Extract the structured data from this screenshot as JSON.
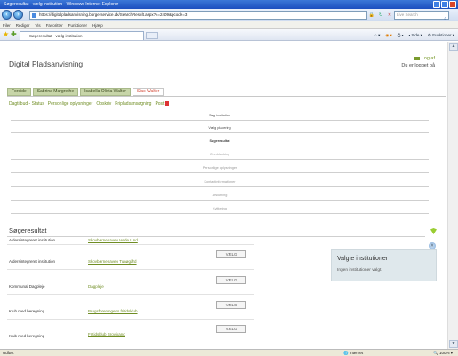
{
  "window": {
    "title": "Søgeresultat - vælg institution - Windows Internet Explorer"
  },
  "address": {
    "url": "https://digitalpladsanvisning.borgerservice.dk/SearchResult.aspx?c=2409&pcode=3",
    "live_search": "Live Search"
  },
  "menu": [
    "Filer",
    "Rediger",
    "Vis",
    "Favoritter",
    "Funktioner",
    "Hjælp"
  ],
  "tab": {
    "title": "Søgeresultat - vælg institution"
  },
  "toolbar": {
    "side": "Side",
    "funktioner": "Funktioner"
  },
  "site": {
    "title": "Digital Pladsanvisning",
    "logout": "Log af",
    "logged_in": "Du er logget på"
  },
  "children": [
    "Forside",
    "Sabrina Margrethe",
    "Isabella Olivia Walter",
    "Siac Walter"
  ],
  "subnav": [
    "Dagtilbud - Status",
    "Personlige oplysninger",
    "Opskriv",
    "Fripladsansøgning",
    "Post"
  ],
  "flow": [
    "Søg institution",
    "Vælg placering",
    "Søgeresultat",
    "Overblanking",
    "Personlige oplysninger",
    "Kontaktinformationer",
    "Afslutning",
    "Kvittering"
  ],
  "results": {
    "title": "Søgeresultat",
    "rows": [
      {
        "type": "Aldersintegreret institution",
        "name": "Skovbørnehaven Hede Lind"
      },
      {
        "type": "Aldersintegreret institution",
        "name": "Skovbørnehaven Tunøgård"
      },
      {
        "type": "Kommunal Dagpleje",
        "name": "Dagpleje"
      },
      {
        "type": "Klub med beregning",
        "name": "Brugsforeningens fritidsklub"
      },
      {
        "type": "Klub med beregning",
        "name": "Fritidsklub Brovikang"
      }
    ],
    "button": "VÆLG"
  },
  "selected": {
    "title": "Valgte institutioner",
    "text": "Ingen institutioner valgt."
  },
  "status": {
    "left": "Udført",
    "zone": "Internet",
    "zoom": "100%"
  }
}
